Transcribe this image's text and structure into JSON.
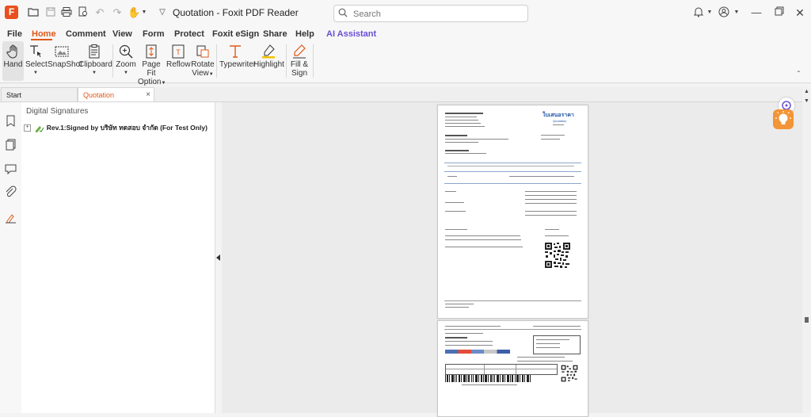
{
  "app": {
    "title": "Quotation - Foxit PDF Reader",
    "logo_letter": "F",
    "search_placeholder": "Search"
  },
  "menu": {
    "items": [
      "File",
      "Home",
      "Comment",
      "View",
      "Form",
      "Protect",
      "Foxit eSign",
      "Share",
      "Help",
      "AI Assistant"
    ],
    "active": "Home"
  },
  "ribbon": {
    "hand": "Hand",
    "select": "Select",
    "snapshot": "SnapShot",
    "clipboard": "Clipboard",
    "zoom": "Zoom",
    "pagefit_1": "Page Fit",
    "pagefit_2": "Option",
    "reflow": "Reflow",
    "rotate_1": "Rotate",
    "rotate_2": "View",
    "typewriter": "Typewriter",
    "highlight": "Highlight",
    "fillsign_1": "Fill &",
    "fillsign_2": "Sign"
  },
  "tabs": {
    "start": "Start",
    "quotation": "Quotation",
    "close": "×"
  },
  "panel": {
    "title": "Digital Signatures",
    "expand": "+",
    "signature": "Rev.1:Signed by บริษัท ทดสอบ จำกัด (For Test Only)"
  },
  "document": {
    "heading": "ใบเสนอราคา",
    "subheading": "Quotation"
  },
  "colors": {
    "accent": "#e05a1a",
    "ai": "#6a4fd6",
    "doc_heading": "#2457a6",
    "bulb": "#f39436"
  }
}
